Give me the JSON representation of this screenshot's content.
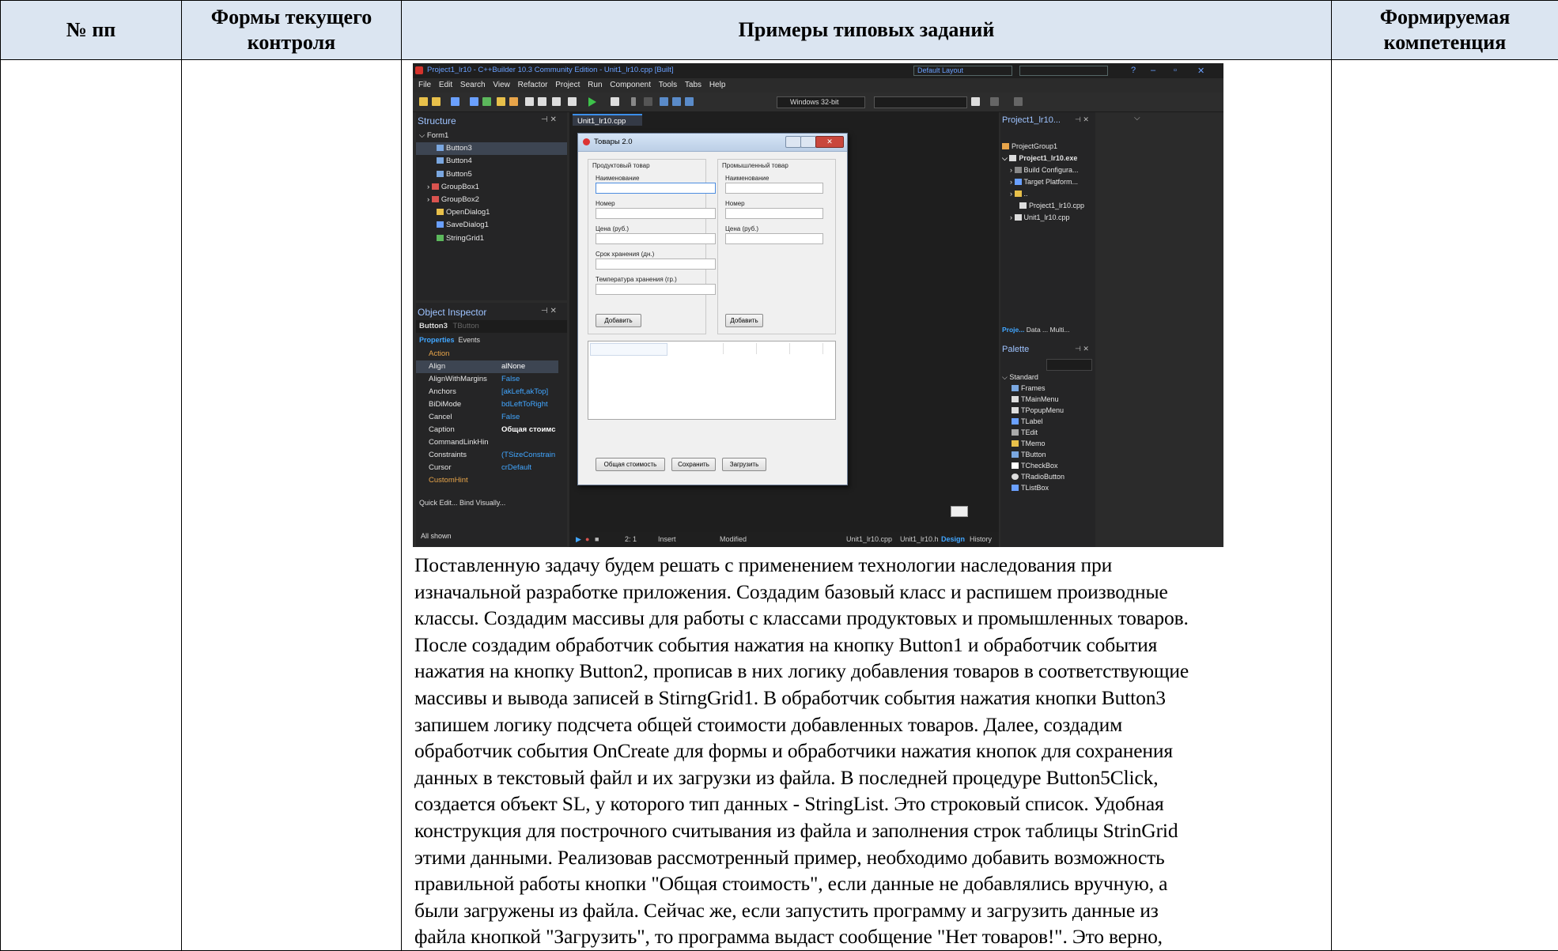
{
  "table": {
    "headers": [
      "№ пп",
      "Формы текущего контроля",
      "Примеры типовых заданий",
      "Формируемая компетенция"
    ]
  },
  "ide": {
    "title": "Project1_lr10 - C++Builder 10.3 Community Edition - Unit1_lr10.cpp [Built]",
    "layout": "Default Layout",
    "menu": [
      "File",
      "Edit",
      "Search",
      "View",
      "Refactor",
      "Project",
      "Run",
      "Component",
      "Tools",
      "Tabs",
      "Help"
    ],
    "platform": "Windows 32-bit",
    "structure": {
      "title": "Structure",
      "items": [
        "Form1",
        "Button3",
        "Button4",
        "Button5",
        "GroupBox1",
        "GroupBox2",
        "OpenDialog1",
        "SaveDialog1",
        "StringGrid1"
      ]
    },
    "editor_tab": "Unit1_lr10.cpp",
    "form": {
      "caption": "Товары 2.0",
      "group1": {
        "title": "Продуктовый товар",
        "labels": [
          "Наименование",
          "Номер",
          "Цена (руб.)",
          "Срок хранения (дн.)",
          "Температура хранения (гр.)"
        ],
        "button": "Добавить"
      },
      "group2": {
        "title": "Промышленный товар",
        "labels": [
          "Наименование",
          "Номер",
          "Цена (руб.)"
        ],
        "button": "Добавить"
      },
      "buttons": [
        "Общая стоимость",
        "Сохранить",
        "Загрузить"
      ]
    },
    "object_inspector": {
      "title": "Object Inspector",
      "selected": "Button3",
      "selected_type": "TButton",
      "tabs": [
        "Properties",
        "Events"
      ],
      "props": [
        {
          "name": "Action",
          "value": ""
        },
        {
          "name": "Align",
          "value": "alNone"
        },
        {
          "name": "AlignWithMargins",
          "value": "False"
        },
        {
          "name": "Anchors",
          "value": "[akLeft,akTop]"
        },
        {
          "name": "BiDiMode",
          "value": "bdLeftToRight"
        },
        {
          "name": "Cancel",
          "value": "False"
        },
        {
          "name": "Caption",
          "value": "Общая стоимс"
        },
        {
          "name": "CommandLinkHin",
          "value": ""
        },
        {
          "name": "Constraints",
          "value": "(TSizeConstrain"
        },
        {
          "name": "Cursor",
          "value": "crDefault"
        },
        {
          "name": "CustomHint",
          "value": ""
        }
      ],
      "footer": "Quick Edit... Bind Visually...",
      "all_shown": "All shown"
    },
    "status": {
      "position": "2: 1",
      "mode": "Insert",
      "state": "Modified",
      "tabs": [
        "Unit1_lr10.cpp",
        "Unit1_lr10.h",
        "Design",
        "History"
      ]
    },
    "project": {
      "title": "Project1_lr10...",
      "items": [
        "ProjectGroup1",
        "Project1_lr10.exe",
        "Build Configura...",
        "Target Platform...",
        "..",
        "Project1_lr10.cpp",
        "Unit1_lr10.cpp"
      ],
      "tabs": [
        "Proje...",
        "Data ...",
        "Multi..."
      ]
    },
    "palette": {
      "title": "Palette",
      "group": "Standard",
      "items": [
        "Frames",
        "TMainMenu",
        "TPopupMenu",
        "TLabel",
        "TEdit",
        "TMemo",
        "TButton",
        "TCheckBox",
        "TRadioButton",
        "TListBox"
      ]
    }
  },
  "body_text": [
    "Поставленную задачу будем решать с применением технологии наследования при",
    "изначальной разработке приложения. Создадим базовый класс и распишем производные",
    "классы. Создадим массивы для работы с классами продуктовых и промышленных товаров.",
    "После создадим обработчик события нажатия на кнопку Button1 и обработчик события",
    "нажатия на кнопку Button2, прописав в них логику добавления товаров в соответствующие",
    "массивы и вывода записей в StirngGrid1. В обработчик события нажатия кнопки Button3",
    "запишем логику подсчета общей стоимости добавленных товаров. Далее, создадим",
    "обработчик события OnCreate для формы и обработчики нажатия кнопок для сохранения",
    "данных в текстовый файл и их загрузки из файла. В последней процедуре Button5Click,",
    "создается объект SL, у которого тип данных - StringList. Это строковый список. Удобная",
    "конструкция для построчного считывания из файла и заполнения строк таблицы StrinGrid",
    "этими данными. Реализовав рассмотренный пример, необходимо добавить возможность",
    "правильной работы кнопки \"Общая стоимость\", если данные не добавлялись вручную, а",
    "были загружены из файла. Сейчас же, если запустить программу и загрузить данные из",
    "файла кнопкой \"Загрузить\", то программа выдаст сообщение \"Нет товаров!\". Это верно,"
  ]
}
